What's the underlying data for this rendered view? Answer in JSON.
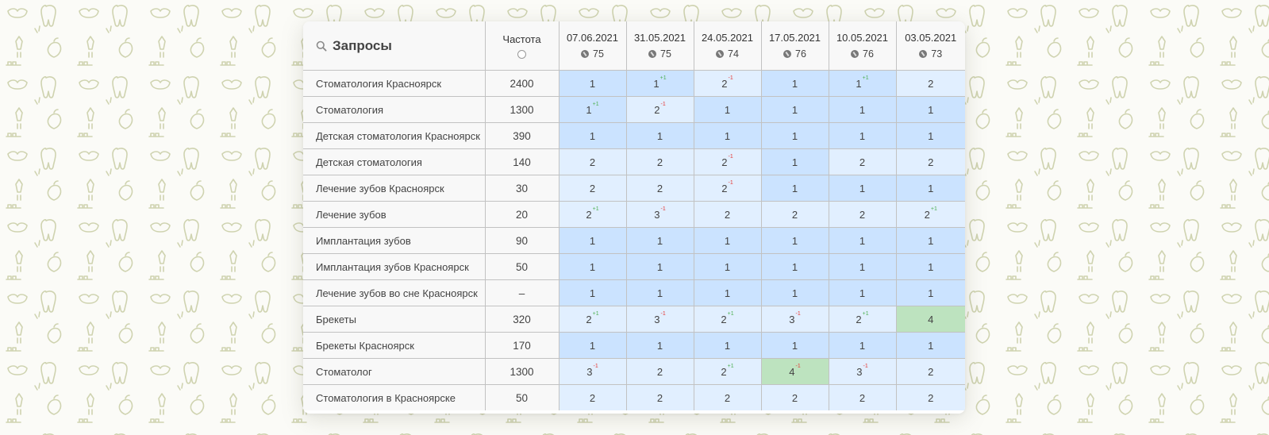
{
  "header": {
    "query_title": "Запросы",
    "freq_title": "Частота",
    "dates": [
      {
        "date": "07.06.2021",
        "score": "75"
      },
      {
        "date": "31.05.2021",
        "score": "75"
      },
      {
        "date": "24.05.2021",
        "score": "74"
      },
      {
        "date": "17.05.2021",
        "score": "76"
      },
      {
        "date": "10.05.2021",
        "score": "76"
      },
      {
        "date": "03.05.2021",
        "score": "73"
      }
    ]
  },
  "colors": {
    "pos1": "#cbe3ff",
    "pos2": "#e1efff",
    "pos3": "#e1efff",
    "pos4": "#bde3bf",
    "up": "#4caf50",
    "down": "#e53935"
  },
  "icons": {
    "query_header": "search-icon",
    "freq_header": "ball-icon",
    "date_header": "google-icon"
  },
  "rows": [
    {
      "query": "Стоматология Красноярск",
      "freq": "2400",
      "positions": [
        {
          "v": "1"
        },
        {
          "v": "1",
          "chg": "+1"
        },
        {
          "v": "2",
          "chg": "-1"
        },
        {
          "v": "1"
        },
        {
          "v": "1",
          "chg": "+1"
        },
        {
          "v": "2"
        }
      ]
    },
    {
      "query": "Стоматология",
      "freq": "1300",
      "positions": [
        {
          "v": "1",
          "chg": "+1"
        },
        {
          "v": "2",
          "chg": "-1"
        },
        {
          "v": "1"
        },
        {
          "v": "1"
        },
        {
          "v": "1"
        },
        {
          "v": "1"
        }
      ]
    },
    {
      "query": "Детская стоматология Красноярск",
      "freq": "390",
      "positions": [
        {
          "v": "1"
        },
        {
          "v": "1"
        },
        {
          "v": "1"
        },
        {
          "v": "1"
        },
        {
          "v": "1"
        },
        {
          "v": "1"
        }
      ]
    },
    {
      "query": "Детская стоматология",
      "freq": "140",
      "positions": [
        {
          "v": "2"
        },
        {
          "v": "2"
        },
        {
          "v": "2",
          "chg": "-1"
        },
        {
          "v": "1"
        },
        {
          "v": "2"
        },
        {
          "v": "2"
        }
      ]
    },
    {
      "query": "Лечение зубов Красноярск",
      "freq": "30",
      "positions": [
        {
          "v": "2"
        },
        {
          "v": "2"
        },
        {
          "v": "2",
          "chg": "-1"
        },
        {
          "v": "1"
        },
        {
          "v": "1"
        },
        {
          "v": "1"
        }
      ]
    },
    {
      "query": "Лечение зубов",
      "freq": "20",
      "positions": [
        {
          "v": "2",
          "chg": "+1"
        },
        {
          "v": "3",
          "chg": "-1"
        },
        {
          "v": "2"
        },
        {
          "v": "2"
        },
        {
          "v": "2"
        },
        {
          "v": "2",
          "chg": "+1"
        }
      ]
    },
    {
      "query": "Имплантация зубов",
      "freq": "90",
      "positions": [
        {
          "v": "1"
        },
        {
          "v": "1"
        },
        {
          "v": "1"
        },
        {
          "v": "1"
        },
        {
          "v": "1"
        },
        {
          "v": "1"
        }
      ]
    },
    {
      "query": "Имплантация зубов Красноярск",
      "freq": "50",
      "positions": [
        {
          "v": "1"
        },
        {
          "v": "1"
        },
        {
          "v": "1"
        },
        {
          "v": "1"
        },
        {
          "v": "1"
        },
        {
          "v": "1"
        }
      ]
    },
    {
      "query": "Лечение зубов во сне Красноярск",
      "freq": "–",
      "positions": [
        {
          "v": "1"
        },
        {
          "v": "1"
        },
        {
          "v": "1"
        },
        {
          "v": "1"
        },
        {
          "v": "1"
        },
        {
          "v": "1"
        }
      ]
    },
    {
      "query": "Брекеты",
      "freq": "320",
      "positions": [
        {
          "v": "2",
          "chg": "+1"
        },
        {
          "v": "3",
          "chg": "-1"
        },
        {
          "v": "2",
          "chg": "+1"
        },
        {
          "v": "3",
          "chg": "-1"
        },
        {
          "v": "2",
          "chg": "+1"
        },
        {
          "v": "4"
        }
      ]
    },
    {
      "query": "Брекеты Красноярск",
      "freq": "170",
      "positions": [
        {
          "v": "1"
        },
        {
          "v": "1"
        },
        {
          "v": "1"
        },
        {
          "v": "1"
        },
        {
          "v": "1"
        },
        {
          "v": "1"
        }
      ]
    },
    {
      "query": "Стоматолог",
      "freq": "1300",
      "positions": [
        {
          "v": "3",
          "chg": "-1"
        },
        {
          "v": "2"
        },
        {
          "v": "2",
          "chg": "+1"
        },
        {
          "v": "4",
          "chg": "-1"
        },
        {
          "v": "3",
          "chg": "-1"
        },
        {
          "v": "2"
        }
      ]
    },
    {
      "query": "Стоматология в Красноярске",
      "freq": "50",
      "positions": [
        {
          "v": "2"
        },
        {
          "v": "2"
        },
        {
          "v": "2"
        },
        {
          "v": "2"
        },
        {
          "v": "2"
        },
        {
          "v": "2"
        }
      ]
    }
  ]
}
